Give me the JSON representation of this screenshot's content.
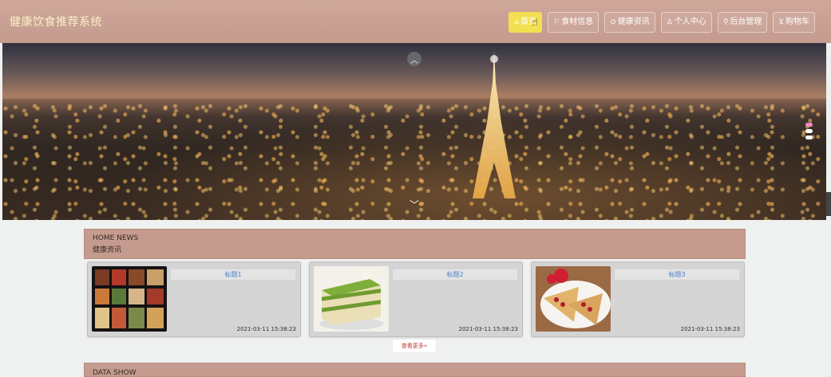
{
  "header": {
    "title": "健康饮食推荐系统",
    "nav": [
      {
        "label": "首页",
        "icon": "home-icon",
        "glyph": "⌂"
      },
      {
        "label": "食材信息",
        "icon": "flag-icon",
        "glyph": "⚐"
      },
      {
        "label": "健康资讯",
        "icon": "info-circle-icon",
        "glyph": "⊙"
      },
      {
        "label": "个人中心",
        "icon": "user-icon",
        "glyph": "♙"
      },
      {
        "label": "后台管理",
        "icon": "link-icon",
        "glyph": "⚲"
      },
      {
        "label": "购物车",
        "icon": "cart-icon",
        "glyph": "⊻"
      }
    ],
    "active_color": "#f3df52"
  },
  "banner": {
    "up_icon": "chevron-up-icon",
    "down_icon": "chevron-down-icon",
    "slide_count": 3
  },
  "news": {
    "en_title": "HOME NEWS",
    "cn_title": "健康资讯",
    "items": [
      {
        "title": "标题1",
        "time": "2021-03-11 15:38:23",
        "image": "bento-box-image"
      },
      {
        "title": "标题2",
        "time": "2021-03-11 15:38:23",
        "image": "matcha-cake-image"
      },
      {
        "title": "标题3",
        "time": "2021-03-11 15:38:23",
        "image": "crepe-image"
      }
    ],
    "more_label": "查看更多"
  },
  "data_show": {
    "en_title": "DATA SHOW"
  }
}
